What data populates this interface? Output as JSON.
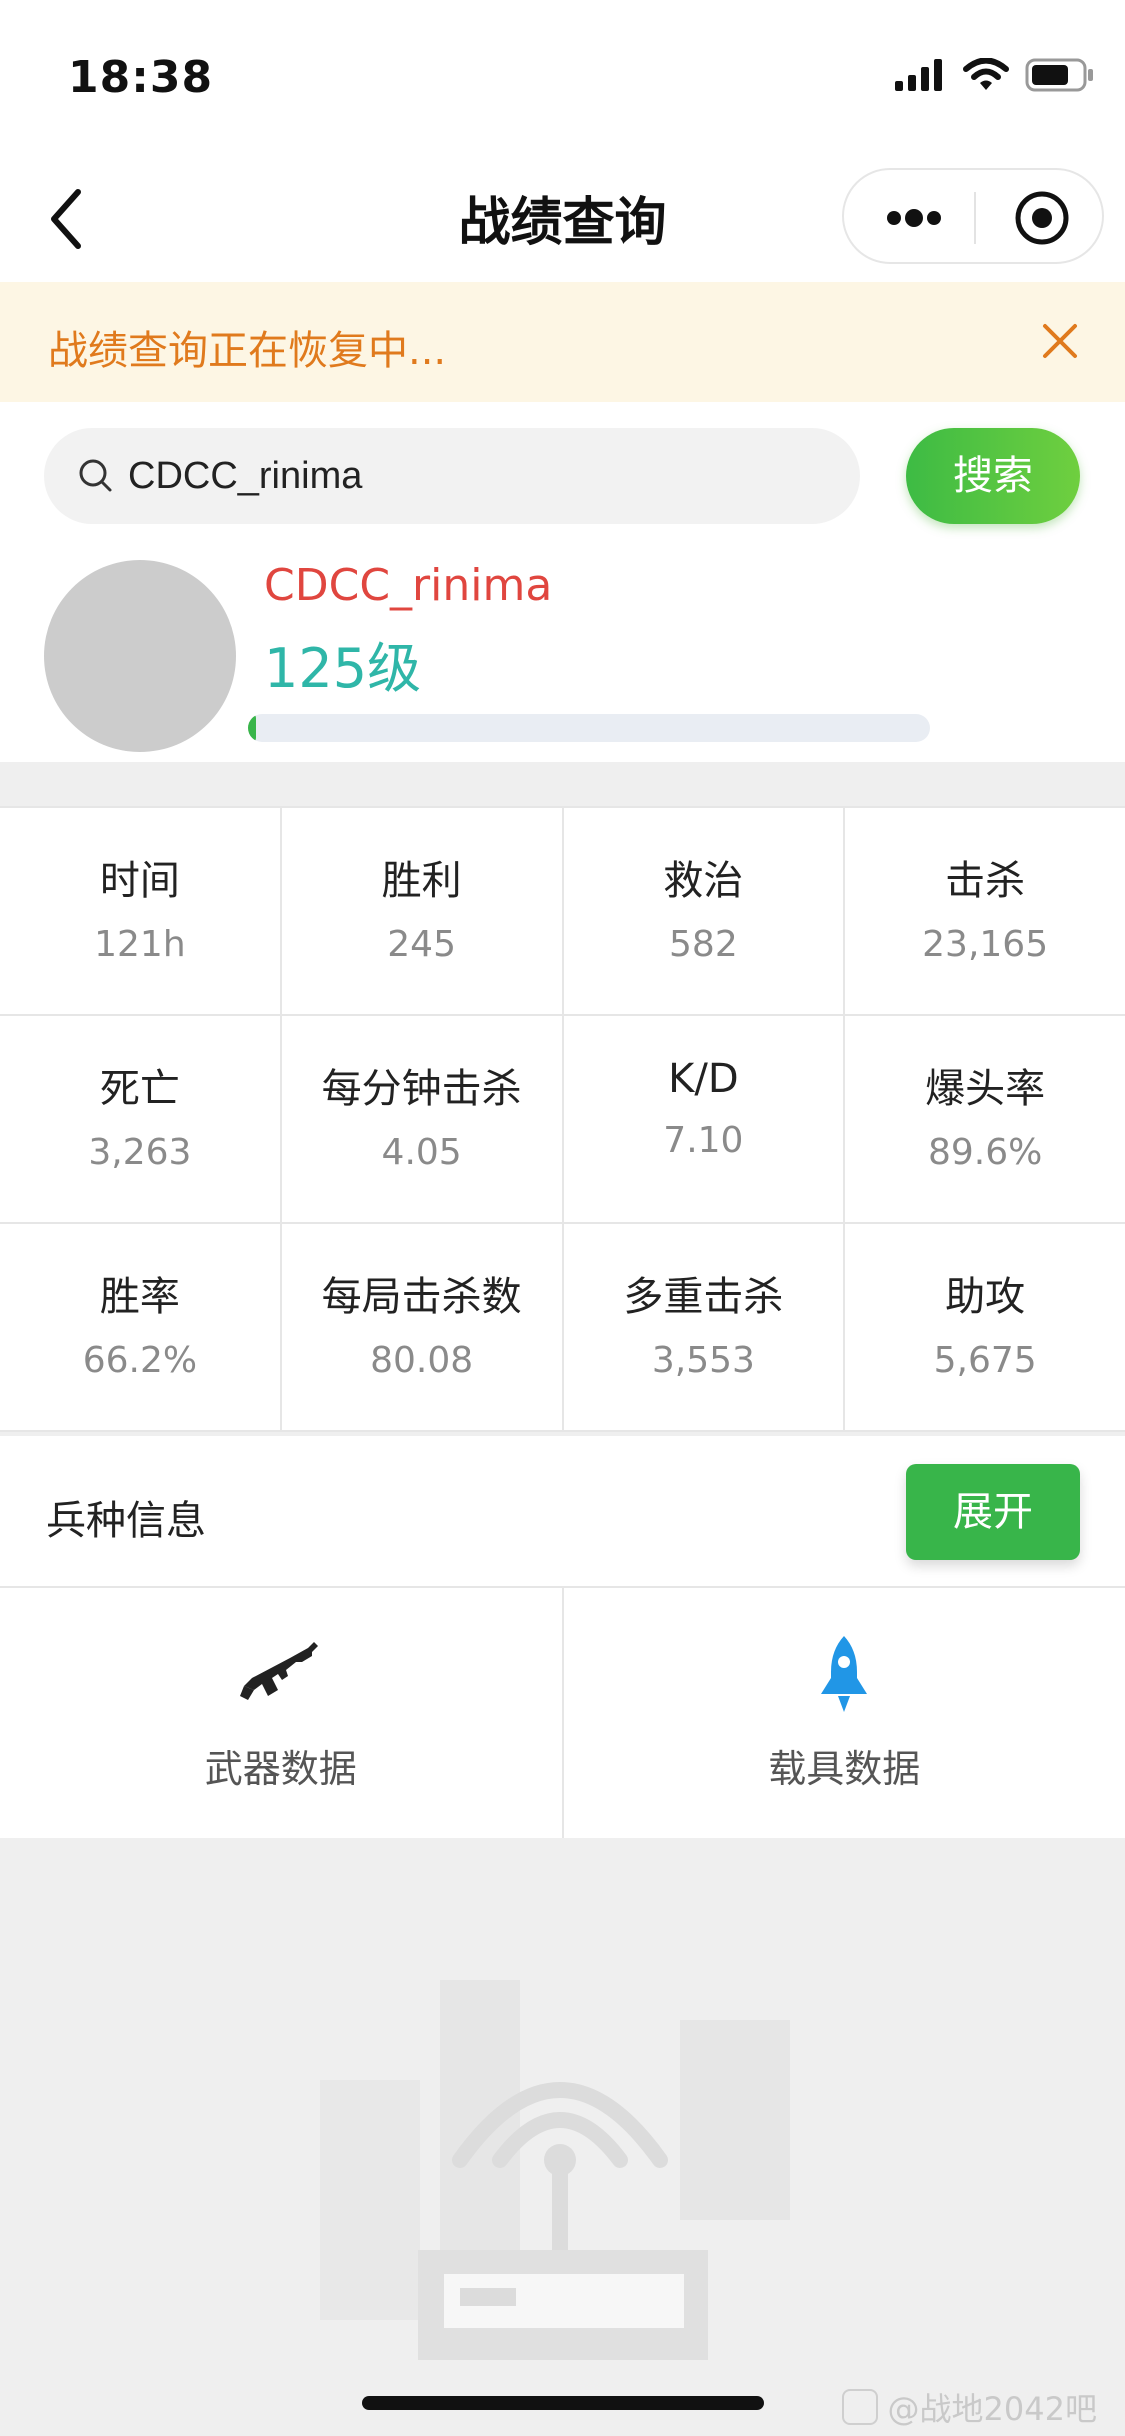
{
  "status_bar": {
    "time": "18:38"
  },
  "nav": {
    "title": "战绩查询"
  },
  "banner": {
    "text": "战绩查询正在恢复中..."
  },
  "search": {
    "value": "CDCC_rinima",
    "button_label": "搜索"
  },
  "profile": {
    "name": "CDCC_rinima",
    "level": "125级",
    "progress_fraction": 0.01
  },
  "stats": [
    [
      {
        "label": "时间",
        "value": "121h"
      },
      {
        "label": "胜利",
        "value": "245"
      },
      {
        "label": "救治",
        "value": "582"
      },
      {
        "label": "击杀",
        "value": "23,165"
      }
    ],
    [
      {
        "label": "死亡",
        "value": "3,263"
      },
      {
        "label": "每分钟击杀",
        "value": "4.05"
      },
      {
        "label": "K/D",
        "value": "7.10"
      },
      {
        "label": "爆头率",
        "value": "89.6%"
      }
    ],
    [
      {
        "label": "胜率",
        "value": "66.2%"
      },
      {
        "label": "每局击杀数",
        "value": "80.08"
      },
      {
        "label": "多重击杀",
        "value": "3,553"
      },
      {
        "label": "助攻",
        "value": "5,675"
      }
    ]
  ],
  "branch": {
    "label": "兵种信息",
    "expand_label": "展开"
  },
  "links": [
    {
      "label": "武器数据",
      "icon": "rifle-icon"
    },
    {
      "label": "载具数据",
      "icon": "rocket-icon"
    }
  ],
  "watermark": {
    "text": "@战地2042吧"
  },
  "colors": {
    "accent_green": "#39b54a",
    "name_red": "#e0463f",
    "level_teal": "#2fb6a8",
    "banner_orange": "#e07a1d",
    "rocket_blue": "#2196e6"
  }
}
